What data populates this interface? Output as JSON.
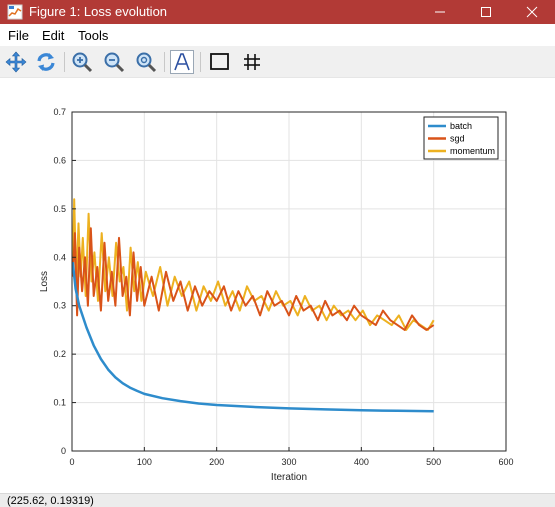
{
  "window": {
    "title": "Figure 1: Loss evolution",
    "icon": "figure-app-icon",
    "controls": [
      "minimize-icon",
      "maximize-icon",
      "close-icon"
    ],
    "titlebar_color": "#b23a36"
  },
  "menu": {
    "items": [
      "File",
      "Edit",
      "Tools"
    ]
  },
  "toolbar": {
    "tools": [
      "pan-icon",
      "rotate-icon",
      "zoom-in-icon",
      "zoom-out-icon",
      "zoom-reset-icon",
      "text-annotation-icon",
      "axes-box-icon",
      "grid-icon"
    ]
  },
  "status": {
    "coordinates": "(225.62, 0.19319)"
  },
  "chart_data": {
    "type": "line",
    "xlabel": "Iteration",
    "ylabel": "Loss",
    "xlim": [
      0,
      600
    ],
    "ylim": [
      0,
      0.7
    ],
    "xticks": [
      "0",
      "100",
      "200",
      "300",
      "400",
      "500",
      "600"
    ],
    "yticks": [
      "0",
      "0.1",
      "0.2",
      "0.3",
      "0.4",
      "0.5",
      "0.6",
      "0.7"
    ],
    "grid": true,
    "legend_position": "top-right",
    "series": [
      {
        "name": "batch",
        "color": "#2e8ccc",
        "x": [
          1,
          5,
          10,
          20,
          30,
          40,
          50,
          60,
          70,
          80,
          90,
          100,
          125,
          150,
          175,
          200,
          250,
          300,
          350,
          400,
          450,
          500
        ],
        "values": [
          0.39,
          0.335,
          0.3,
          0.255,
          0.218,
          0.19,
          0.168,
          0.152,
          0.14,
          0.131,
          0.124,
          0.118,
          0.109,
          0.103,
          0.098,
          0.095,
          0.091,
          0.088,
          0.086,
          0.084,
          0.083,
          0.082
        ]
      },
      {
        "name": "sgd",
        "color": "#d95319",
        "x": [
          1,
          4,
          7,
          10,
          14,
          18,
          22,
          26,
          30,
          35,
          40,
          45,
          50,
          55,
          60,
          65,
          70,
          75,
          80,
          85,
          90,
          95,
          100,
          110,
          120,
          130,
          140,
          150,
          160,
          170,
          180,
          190,
          200,
          210,
          220,
          230,
          240,
          250,
          260,
          270,
          280,
          290,
          300,
          310,
          320,
          330,
          340,
          350,
          360,
          370,
          380,
          390,
          400,
          410,
          420,
          430,
          440,
          450,
          460,
          470,
          480,
          490,
          500
        ],
        "values": [
          0.36,
          0.45,
          0.28,
          0.42,
          0.33,
          0.4,
          0.3,
          0.46,
          0.32,
          0.38,
          0.29,
          0.43,
          0.31,
          0.37,
          0.3,
          0.44,
          0.32,
          0.36,
          0.28,
          0.41,
          0.31,
          0.38,
          0.3,
          0.36,
          0.29,
          0.37,
          0.31,
          0.35,
          0.29,
          0.34,
          0.3,
          0.33,
          0.31,
          0.34,
          0.29,
          0.33,
          0.3,
          0.32,
          0.28,
          0.33,
          0.3,
          0.31,
          0.28,
          0.32,
          0.29,
          0.3,
          0.27,
          0.31,
          0.28,
          0.29,
          0.27,
          0.3,
          0.28,
          0.27,
          0.26,
          0.29,
          0.27,
          0.26,
          0.25,
          0.28,
          0.26,
          0.25,
          0.26
        ]
      },
      {
        "name": "momentum",
        "color": "#edb120",
        "x": [
          1,
          3,
          6,
          9,
          12,
          15,
          19,
          23,
          27,
          31,
          36,
          41,
          46,
          51,
          56,
          61,
          66,
          71,
          76,
          81,
          86,
          91,
          96,
          102,
          112,
          122,
          132,
          142,
          152,
          162,
          172,
          182,
          192,
          202,
          212,
          222,
          232,
          242,
          252,
          262,
          272,
          282,
          292,
          302,
          312,
          322,
          332,
          342,
          352,
          362,
          372,
          382,
          392,
          402,
          412,
          422,
          432,
          442,
          452,
          462,
          472,
          482,
          492,
          500
        ],
        "values": [
          0.38,
          0.52,
          0.34,
          0.47,
          0.36,
          0.44,
          0.32,
          0.49,
          0.35,
          0.41,
          0.31,
          0.45,
          0.33,
          0.4,
          0.32,
          0.43,
          0.35,
          0.38,
          0.29,
          0.42,
          0.33,
          0.39,
          0.31,
          0.37,
          0.32,
          0.38,
          0.3,
          0.36,
          0.32,
          0.35,
          0.29,
          0.34,
          0.31,
          0.35,
          0.3,
          0.33,
          0.29,
          0.34,
          0.31,
          0.32,
          0.29,
          0.33,
          0.3,
          0.31,
          0.28,
          0.32,
          0.29,
          0.3,
          0.27,
          0.3,
          0.28,
          0.29,
          0.27,
          0.29,
          0.26,
          0.28,
          0.27,
          0.26,
          0.28,
          0.25,
          0.27,
          0.26,
          0.25,
          0.27
        ]
      }
    ]
  }
}
